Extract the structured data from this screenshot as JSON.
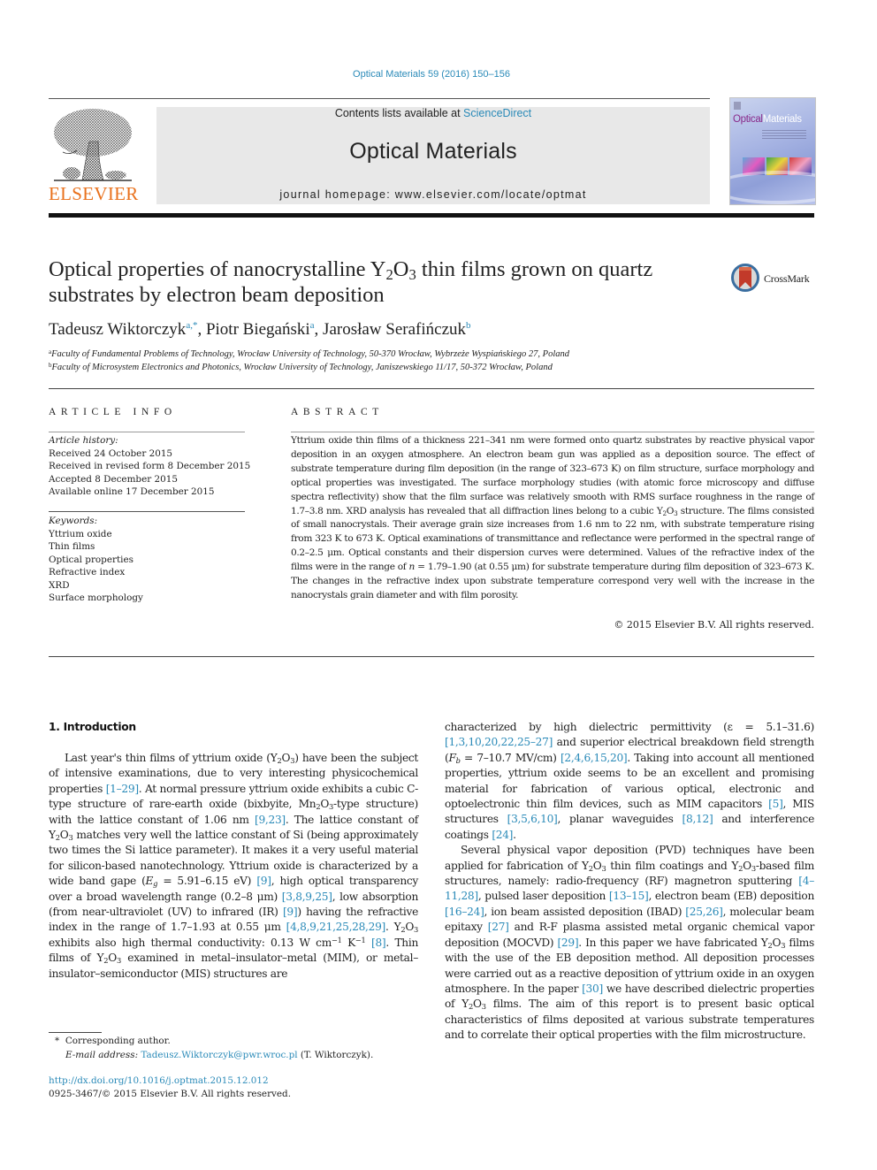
{
  "header": {
    "journal_citation": "Optical Materials 59 (2016) 150–156",
    "contents_prefix": "Contents lists available at ",
    "contents_link": "ScienceDirect",
    "journal_title": "Optical Materials",
    "homepage_prefix": "journal homepage: ",
    "homepage_url": "www.elsevier.com/locate/optmat",
    "publisher_logo_text": "ELSEVIER",
    "cover_title_part1": "Optical",
    "cover_title_part2": "Materials",
    "brand_color": "#e9711c",
    "link_color": "#2a8ab8"
  },
  "article": {
    "title_part1": "Optical properties of nanocrystalline Y",
    "title_sub1": "2",
    "title_part2": "O",
    "title_sub2": "3",
    "title_part3": " thin films grown on quartz substrates by electron beam deposition",
    "crossmark_label": "CrossMark",
    "authors": [
      {
        "name": "Tadeusz Wiktorczyk",
        "marks": "a,*"
      },
      {
        "name": "Piotr Biegański",
        "marks": "a"
      },
      {
        "name": "Jarosław Serafińczuk",
        "marks": "b"
      }
    ],
    "affiliations": [
      {
        "mark": "a",
        "text": "Faculty of Fundamental Problems of Technology, Wrocław University of Technology, 50-370 Wrocław, Wybrzeże Wyspiańskiego 27, Poland"
      },
      {
        "mark": "b",
        "text": "Faculty of Microsystem Electronics and Photonics, Wrocław University of Technology, Janiszewskiego 11/17, 50-372 Wrocław, Poland"
      }
    ]
  },
  "article_info": {
    "heading": "ARTICLE INFO",
    "history_label": "Article history:",
    "history": [
      "Received 24 October 2015",
      "Received in revised form 8 December 2015",
      "Accepted 8 December 2015",
      "Available online 17 December 2015"
    ],
    "keywords_label": "Keywords:",
    "keywords": [
      "Yttrium oxide",
      "Thin films",
      "Optical properties",
      "Refractive index",
      "XRD",
      "Surface morphology"
    ]
  },
  "abstract": {
    "heading": "ABSTRACT",
    "s1": "Yttrium oxide thin films of a thickness 221–341 nm were formed onto quartz substrates by reactive phys­ical vapor deposition in an oxygen atmosphere. An electron beam gun was applied as a deposition source. The effect of substrate temperature during film deposition (in the range of 323–673 K) on film structure, surface morphology and optical properties was investigated. The surface morphology studies (with atomic force microscopy and diffuse spectra reflectivity) show that the film surface was relatively smooth with RMS surface roughness in the range of 1.7–3.8 nm. XRD analysis has revealed that all diffraction lines belong to a cubic Y",
    "s1_sub1": "2",
    "s1_o": "O",
    "s1_sub2": "3",
    "s2": " structure. The films consisted of small nanocrystals. Their average grain size increases from 1.6 nm to 22 nm, with substrate temperature rising from 323 K to 673 K. Optical exami­nations of transmittance and reflectance were performed in the spectral range of 0.2–2.5 μm. Optical con­stants and their dispersion curves were determined. Values of the refractive index of the films were in the range of ",
    "s2_var": "n",
    "s3": " = 1.79–1.90 (at 0.55 μm) for substrate temperature during film deposition of 323–673 K. The changes in the refractive index upon substrate temperature correspond very well with the increase in the nanocrystals grain diameter and with film porosity.",
    "copyright": "© 2015 Elsevier B.V. All rights reserved."
  },
  "introduction": {
    "heading": "1. Introduction",
    "left": {
      "t1": "Last year's thin films of yttrium oxide (Y",
      "t2": ") have been the sub­ject of intensive examinations, due to very interesting physico­chemical properties ",
      "r1": "[1–29]",
      "t3": ". At normal pressure yttrium oxide exhibits a cubic C-type structure of rare-earth oxide (bixbyite, Mn",
      "t4": "-type structure) with the lattice constant of 1.06 nm ",
      "r2": "[9,23]",
      "t5": ". The lattice constant of Y",
      "t6": " matches very well the lattice constant of Si (being approximately two times the Si lattice param­eter). It makes it a very useful material for silicon-based nanotech­nology. Yttrium oxide is characterized by a wide band gape (",
      "eg_var": "E",
      "eg_sub": "g",
      "t7": " = 5.91–6.15 eV) ",
      "r3": "[9]",
      "t8": ", high optical transparency over a broad wavelength range (0.2–8 μm) ",
      "r4": "[3,8,9,25]",
      "t9": ", low absorption (from near-ultraviolet (UV) to infrared (IR) ",
      "r5": "[9]",
      "t10": ") having the refractive index in the range of 1.7–1.93 at 0.55 μm ",
      "r6": "[4,8,9,21,25,28,29]",
      "t11": ". Y",
      "t12": " exhibits also high thermal conductivity: 0.13 W cm",
      "t13": " K",
      "sup_neg1": "−1",
      "r7": "[8]",
      "t14": ". Thin films of Y",
      "t15": " examined in metal–insulator–metal (MIM), or metal–insulator–semiconductor (MIS) structures are"
    },
    "right": {
      "p1_t1": "characterized by high dielectric permittivity (ε = 5.1–31.6) ",
      "p1_r1": "[1,3,10,20,22,25–27]",
      "p1_t2": " and superior electrical breakdown field strength (",
      "fb_var": "F",
      "fb_sub": "b",
      "p1_t3": " = 7–10.7 MV/cm) ",
      "p1_r2": "[2,4,6,15,20]",
      "p1_t4": ". Taking into account all mentioned properties, yttrium oxide seems to be an excellent and promising material for fabrication of various optical, electronic and optoelectronic thin film devices, such as MIM capacitors ",
      "p1_r3": "[5]",
      "p1_t5": ", MIS structures ",
      "p1_r4": "[3,5,6,10]",
      "p1_t6": ", planar waveguides ",
      "p1_r5": "[8,12]",
      "p1_t7": " and interfer­ence coatings ",
      "p1_r6": "[24]",
      "p1_t8": ".",
      "p2_t1": "Several physical vapor deposition (PVD) techniques have been applied for fabrication of Y",
      "p2_t2": " thin film coatings and Y",
      "p2_t3": "-based film structures, namely: radio-frequency (RF) magnetron sputter­ing ",
      "p2_r1": "[4–11,28]",
      "p2_t4": ", pulsed laser deposition ",
      "p2_r2": "[13–15]",
      "p2_t5": ", electron beam (EB) deposition ",
      "p2_r3": "[16–24]",
      "p2_t6": ", ion beam assisted deposition (IBAD) ",
      "p2_r4": "[25,26]",
      "p2_t7": ", molecular beam epitaxy ",
      "p2_r5": "[27]",
      "p2_t8": " and R-F plasma assisted metal organic chemical vapor deposition (MOCVD) ",
      "p2_r6": "[29]",
      "p2_t9": ". In this paper we have fabricated Y",
      "p2_t10": " films with the use of the EB depo­sition method. All deposition processes were carried out as a reac­tive deposition of yttrium oxide in an oxygen atmosphere. In the paper ",
      "p2_r7": "[30]",
      "p2_t11": " we have described dielectric properties of Y",
      "p2_t12": " films. The aim of this report is to present basic optical characteristics of films deposited at various substrate temperatures and to correlate their optical properties with the film microstructure."
    },
    "chem": {
      "o": "O",
      "two": "2",
      "three": "3"
    }
  },
  "footnotes": {
    "corresponding_mark": "*",
    "corresponding_text": "Corresponding author.",
    "email_label": "E-mail address:",
    "email": "Tadeusz.Wiktorczyk@pwr.wroc.pl",
    "email_suffix": " (T. Wiktorczyk).",
    "doi": "http://dx.doi.org/10.1016/j.optmat.2015.12.012",
    "issn_line": "0925-3467/© 2015 Elsevier B.V. All rights reserved."
  }
}
